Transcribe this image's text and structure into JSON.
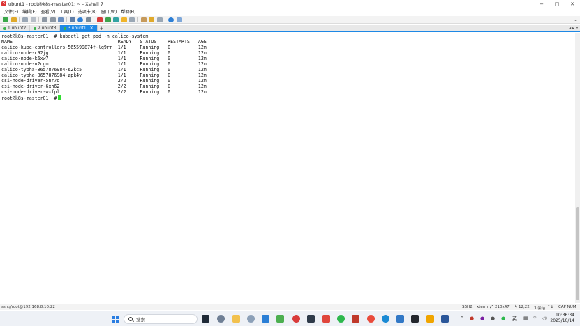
{
  "window": {
    "title": "ubunt1 - root@k8s-master01: ~ - Xshell 7",
    "buttons": {
      "minimize": "−",
      "maximize": "□",
      "close": "✕"
    }
  },
  "menu": [
    "文件(F)",
    "编辑(E)",
    "查看(V)",
    "工具(T)",
    "选项卡(B)",
    "窗口(W)",
    "帮助(H)"
  ],
  "toolbar": {
    "overflow": "⌄"
  },
  "tabs": [
    {
      "label": "1 ubunt2",
      "active": false
    },
    {
      "label": "2 ubunt3",
      "active": false
    },
    {
      "label": "3 ubunt1",
      "active": true
    }
  ],
  "tab_add": "+",
  "tab_nav": "◂ ▸ ▾",
  "terminal": {
    "lines": [
      "root@k8s-master01:~# kubectl get pod -n calico-system",
      "NAME                                      READY   STATUS    RESTARTS   AGE",
      "calico-kube-controllers-565599874f-lq9rr  1/1     Running   0          12m",
      "calico-node-c92jg                         1/1     Running   0          12m",
      "calico-node-k6xw7                         1/1     Running   0          12m",
      "calico-node-n2cgm                         1/1     Running   0          12m",
      "calico-typha-8657876984-s2kc5             1/1     Running   0          12m",
      "calico-typha-8657876984-zpk4v             1/1     Running   0          12m",
      "csi-node-driver-5nr7d                     2/2     Running   0          12m",
      "csi-node-driver-6xh62                     2/2     Running   0          12m",
      "csi-node-driver-wxfpl                     2/2     Running   0          12m"
    ],
    "prompt": "root@k8s-master01:~#"
  },
  "status": {
    "connection": "ssh://root@192.168.8.10:22",
    "protocol": "SSH2",
    "term": "xterm",
    "size": "210x47",
    "position": "12,22",
    "sessions": "3 会话",
    "caps": "CAP NUM"
  },
  "taskbar": {
    "search_placeholder": "搜索",
    "ime": "英",
    "time": "10:36:34",
    "date": "2025/10/14"
  }
}
